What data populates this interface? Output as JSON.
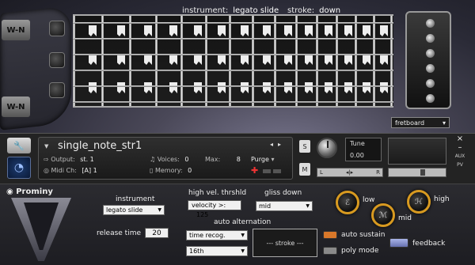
{
  "header": {
    "instrument_label": "instrument:",
    "instrument_value": "legato slide",
    "stroke_label": "stroke:",
    "stroke_value": "down",
    "view_select": "fretboard",
    "headstock_logo": "W-N"
  },
  "kontakt": {
    "instrument_name": "single_note_str1",
    "output_label": "Output:",
    "output_value": "st. 1",
    "voices_label": "Voices:",
    "voices_value": "0",
    "max_label": "Max:",
    "max_value": "8",
    "purge_label": "Purge",
    "midi_label": "Midi Ch:",
    "midi_value": "[A] 1",
    "memory_label": "Memory:",
    "memory_value": "0",
    "solo_label": "S",
    "mute_label": "M",
    "tune_label": "Tune",
    "tune_value": "0.00",
    "pan_left": "L",
    "pan_right": "R",
    "aux_label": "AUX",
    "pv_label": "PV",
    "close_label": "×",
    "minimize_label": "–",
    "nav_prev": "◂",
    "nav_next": "▸"
  },
  "panel": {
    "brand": "Prominy",
    "instrument_title": "instrument",
    "instrument_select": "legato slide",
    "release_time_label": "release time",
    "release_time_value": "20",
    "high_vel_label": "high vel. thrshld",
    "velocity_label": "velocity >:",
    "velocity_value": "125",
    "gliss_label": "gliss down",
    "gliss_select": "mid",
    "alternation_label": "auto alternation",
    "recog_select": "time recog.",
    "division_select": "16th",
    "stroke_box": "--- stroke ---",
    "auto_sustain_label": "auto sustain",
    "poly_mode_label": "poly mode",
    "low_label": "low",
    "mid_label": "mid",
    "high_label": "high",
    "feedback_label": "feedback"
  },
  "colors": {
    "auto_sustain_on": "#d9782a",
    "poly_mode_off": "#8a8a8a",
    "knob_ring": "#d89a20",
    "feedback_button": "#8f9ad6"
  }
}
